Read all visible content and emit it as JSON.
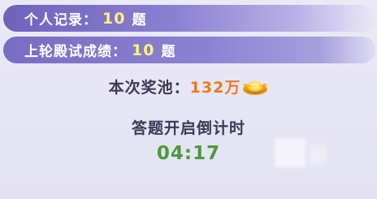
{
  "personal_record": {
    "label": "个人记录：",
    "value": "10",
    "unit": "题"
  },
  "last_round": {
    "label": "上轮殿试成绩：",
    "value": "10",
    "unit": "题"
  },
  "prize_pool": {
    "label": "本次奖池：",
    "amount": "132万",
    "icon": "gold-ingot-icon"
  },
  "countdown": {
    "label": "答题开启倒计时",
    "time": "04:17"
  },
  "colors": {
    "bar_purple": "#6e62bd",
    "number_yellow": "#fff27a",
    "amount_orange": "#ee7a1e",
    "timer_green": "#4b9a3d",
    "text_dark": "#3e3757"
  }
}
